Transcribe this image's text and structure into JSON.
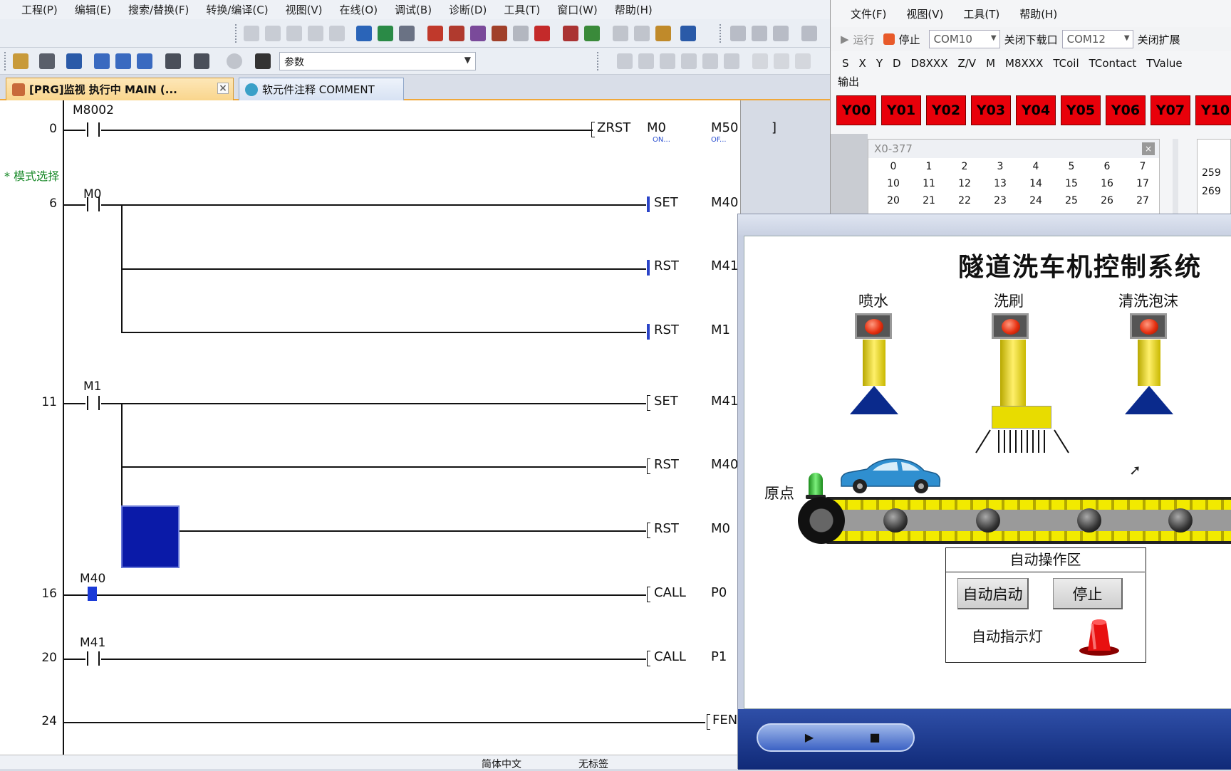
{
  "ide": {
    "menu": [
      "工程(P)",
      "编辑(E)",
      "搜索/替换(F)",
      "转换/编译(C)",
      "视图(V)",
      "在线(O)",
      "调试(B)",
      "诊断(D)",
      "工具(T)",
      "窗口(W)",
      "帮助(H)"
    ],
    "param_select": "参数",
    "tabs": {
      "main": "[PRG]监视 执行中 MAIN (...",
      "comment": "软元件注释 COMMENT"
    },
    "comment_line": "* 模式选择",
    "status": {
      "lang": "简体中文",
      "label": "无标签"
    }
  },
  "ladder": {
    "rungs": [
      {
        "step": "0",
        "contact": "M8002",
        "instr": "ZRST",
        "op1": "M0",
        "op1_state": "ON...",
        "op2": "M50",
        "op2_state": "OF..."
      },
      {
        "step": "6",
        "contact": "M0",
        "lines": [
          {
            "instr": "SET",
            "op": "M40"
          },
          {
            "instr": "RST",
            "op": "M41"
          },
          {
            "instr": "RST",
            "op": "M1"
          }
        ]
      },
      {
        "step": "11",
        "contact": "M1",
        "lines": [
          {
            "instr": "SET",
            "op": "M41"
          },
          {
            "instr": "RST",
            "op": "M40"
          },
          {
            "instr": "RST",
            "op": "M0"
          }
        ]
      },
      {
        "step": "16",
        "contact": "M40",
        "instr": "CALL",
        "op": "P0"
      },
      {
        "step": "20",
        "contact": "M41",
        "instr": "CALL",
        "op": "P1"
      },
      {
        "step": "24",
        "instr": "FEN"
      }
    ]
  },
  "sim": {
    "menu": [
      "文件(F)",
      "视图(V)",
      "工具(T)",
      "帮助(H)"
    ],
    "run_label": "运行",
    "stop_label": "停止",
    "com_download": "COM10",
    "close_download": "关闭下载口",
    "com_expand": "COM12",
    "close_expand": "关闭扩展",
    "registers": [
      "S",
      "X",
      "Y",
      "D",
      "D8XXX",
      "Z/V",
      "M",
      "M8XXX",
      "TCoil",
      "TContact",
      "TValue"
    ],
    "output_label": "输出",
    "outputs": [
      "Y00",
      "Y01",
      "Y02",
      "Y03",
      "Y04",
      "Y05",
      "Y06",
      "Y07",
      "Y10"
    ],
    "x_panel_title": "X0-377",
    "x_grid": [
      "0",
      "1",
      "2",
      "3",
      "4",
      "5",
      "6",
      "7",
      "10",
      "11",
      "12",
      "13",
      "14",
      "15",
      "16",
      "17",
      "20",
      "21",
      "22",
      "23",
      "24",
      "25",
      "26",
      "27"
    ],
    "side_values": [
      "259",
      "269"
    ]
  },
  "hmi": {
    "title": "隧道洗车机控制系统",
    "spray": "喷水",
    "brush": "洗刷",
    "foam": "清洗泡沫",
    "origin": "原点",
    "auto_area": "自动操作区",
    "auto_start": "自动启动",
    "stop": "停止",
    "auto_indicator": "自动指示灯",
    "colors": {
      "lamp_red": "#e63010",
      "output_red": "#e8000a",
      "nozzle_blue": "#0a2a8c",
      "belt_yellow": "#f2ea00"
    }
  }
}
